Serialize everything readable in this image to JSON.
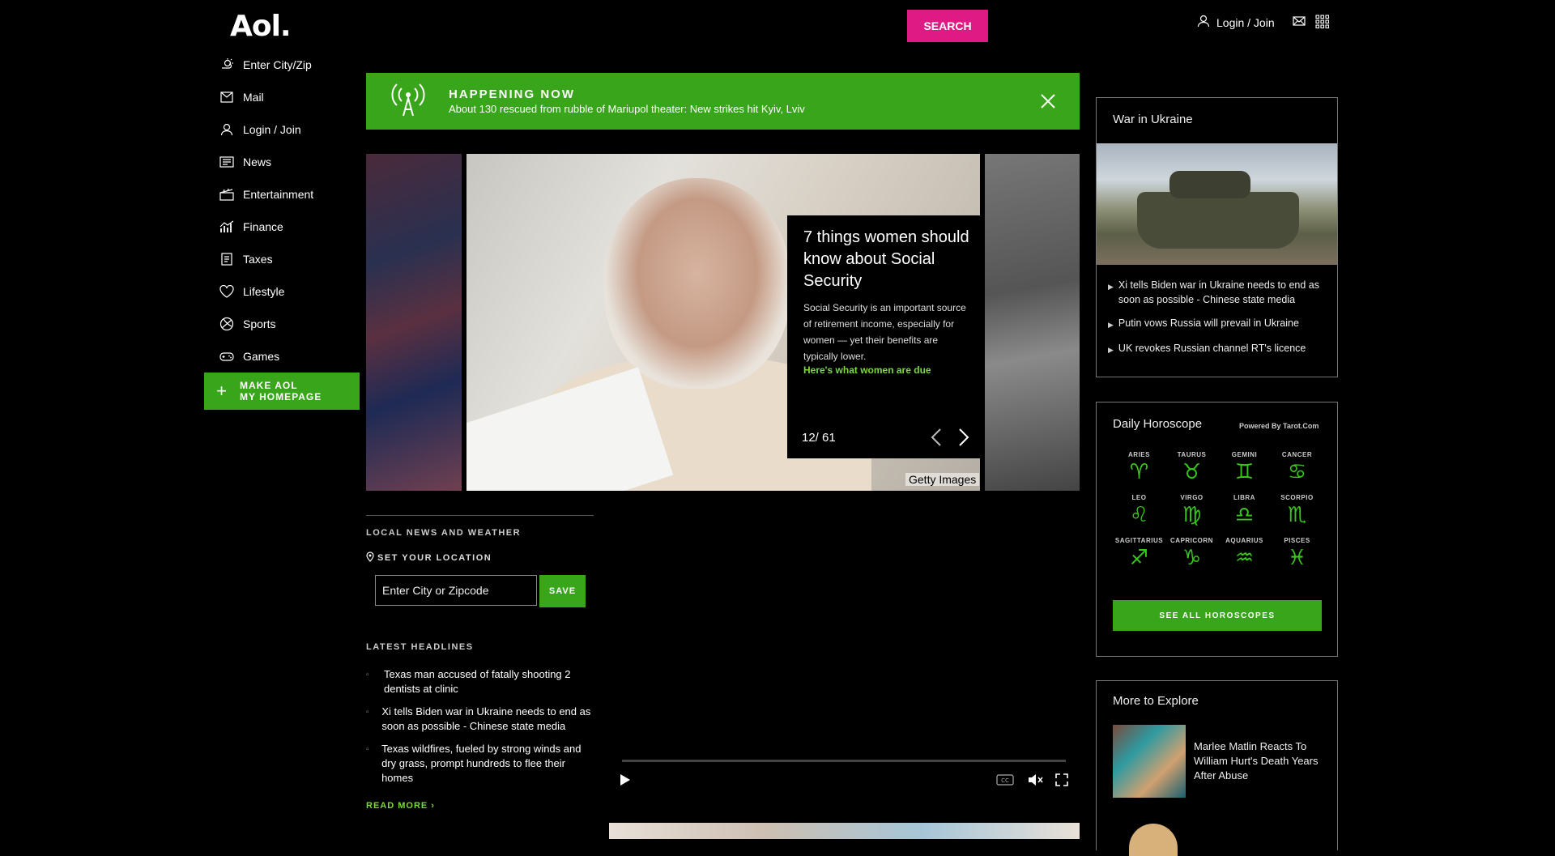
{
  "header": {
    "logo": "Aol.",
    "search_label": "SEARCH",
    "login_label": "Login / Join"
  },
  "sidebar": {
    "items": [
      {
        "label": "Enter City/Zip",
        "icon": "weather-icon"
      },
      {
        "label": "Mail",
        "icon": "mail-icon"
      },
      {
        "label": "Login / Join",
        "icon": "user-icon"
      },
      {
        "label": "News",
        "icon": "news-icon"
      },
      {
        "label": "Entertainment",
        "icon": "entertainment-icon"
      },
      {
        "label": "Finance",
        "icon": "finance-icon"
      },
      {
        "label": "Taxes",
        "icon": "taxes-icon"
      },
      {
        "label": "Lifestyle",
        "icon": "lifestyle-icon"
      },
      {
        "label": "Sports",
        "icon": "sports-icon"
      },
      {
        "label": "Games",
        "icon": "games-icon"
      }
    ],
    "make_aol_line1": "MAKE AOL",
    "make_aol_line2": "MY HOMEPAGE"
  },
  "happening": {
    "title": "HAPPENING NOW",
    "text": "About 130 rescued from rubble of Mariupol theater: New strikes hit Kyiv, Lviv"
  },
  "slideshow": {
    "title": "7 things women should know about Social Security",
    "body": "Social Security is an important source of retirement income, especially for women — yet their benefits are typically lower.",
    "link": "Here's what women are due",
    "counter": "12/ 61",
    "credit": "Getty Images"
  },
  "local": {
    "title": "LOCAL NEWS AND WEATHER",
    "set_location": "SET YOUR LOCATION",
    "input_placeholder": "Enter City or Zipcode",
    "save_label": "SAVE"
  },
  "latest": {
    "title": "LATEST HEADLINES",
    "headlines": [
      "Texas man accused of fatally shooting 2 dentists at clinic",
      "Xi tells Biden war in Ukraine needs to end as soon as possible - Chinese state media",
      "Texas wildfires, fueled by strong winds and dry grass, prompt hundreds to flee their homes"
    ],
    "read_more": "READ MORE ›"
  },
  "ukraine": {
    "title": "War in Ukraine",
    "items": [
      "Xi tells Biden war in Ukraine needs to end as soon as possible - Chinese state media",
      "Putin vows Russia will prevail in Ukraine",
      "UK revokes Russian channel RT's licence"
    ]
  },
  "horoscope": {
    "title": "Daily Horoscope",
    "powered": "Powered By Tarot.Com",
    "signs": [
      {
        "name": "ARIES",
        "symbol": "♈"
      },
      {
        "name": "TAURUS",
        "symbol": "♉"
      },
      {
        "name": "GEMINI",
        "symbol": "♊"
      },
      {
        "name": "CANCER",
        "symbol": "♋"
      },
      {
        "name": "LEO",
        "symbol": "♌"
      },
      {
        "name": "VIRGO",
        "symbol": "♍"
      },
      {
        "name": "LIBRA",
        "symbol": "♎"
      },
      {
        "name": "SCORPIO",
        "symbol": "♏"
      },
      {
        "name": "SAGITTARIUS",
        "symbol": "♐"
      },
      {
        "name": "CAPRICORN",
        "symbol": "♑"
      },
      {
        "name": "AQUARIUS",
        "symbol": "♒"
      },
      {
        "name": "PISCES",
        "symbol": "♓"
      }
    ],
    "see_all": "SEE ALL HOROSCOPES"
  },
  "explore": {
    "title": "More to Explore",
    "item1": "Marlee Matlin Reacts To William Hurt's Death Years After Abuse"
  },
  "colors": {
    "accent_green": "#39a51b",
    "search_pink": "#e01a84",
    "link_green": "#7bd93a"
  }
}
